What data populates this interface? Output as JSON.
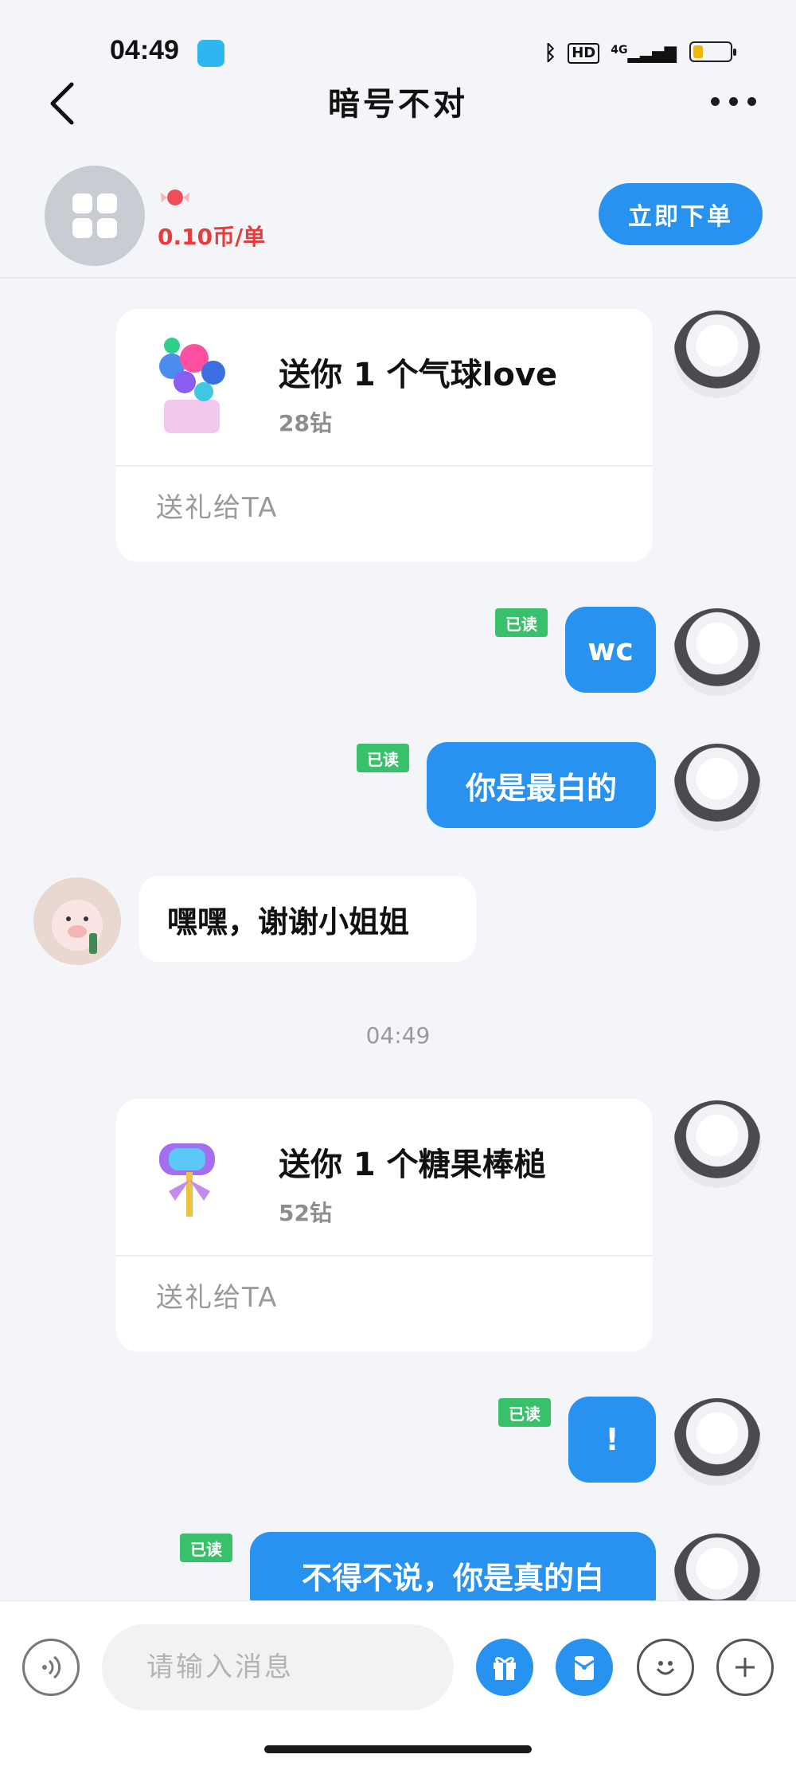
{
  "status": {
    "time": "04:49",
    "hd": "HD",
    "network": "4G"
  },
  "header": {
    "title": "暗号不对"
  },
  "order": {
    "price": "0.10币/单",
    "button": "立即下单"
  },
  "messages": [
    {
      "type": "gift",
      "title": "送你 1 个气球love",
      "price": "28钻",
      "action": "送礼给TA"
    },
    {
      "type": "text",
      "text": "wc",
      "read": "已读"
    },
    {
      "type": "text",
      "text": "你是最白的",
      "read": "已读"
    },
    {
      "type": "text_other",
      "text": "嘿嘿，谢谢小姐姐"
    },
    {
      "type": "time",
      "text": "04:49"
    },
    {
      "type": "gift",
      "title": "送你 1 个糖果棒槌",
      "price": "52钻",
      "action": "送礼给TA"
    },
    {
      "type": "text",
      "text": "!",
      "read": "已读"
    },
    {
      "type": "text",
      "text": "不得不说，你是真的白",
      "read": "已读"
    }
  ],
  "input": {
    "placeholder": "请输入消息"
  },
  "icons": {
    "back": "back-arrow-icon",
    "more": "more-dots-icon",
    "voice": "voice-icon",
    "gift": "gift-icon",
    "redpacket": "red-packet-icon",
    "emoji": "emoji-icon",
    "plus": "plus-icon"
  },
  "colors": {
    "accent": "#2892f1",
    "read": "#39c06a",
    "price": "#e73c3c"
  }
}
